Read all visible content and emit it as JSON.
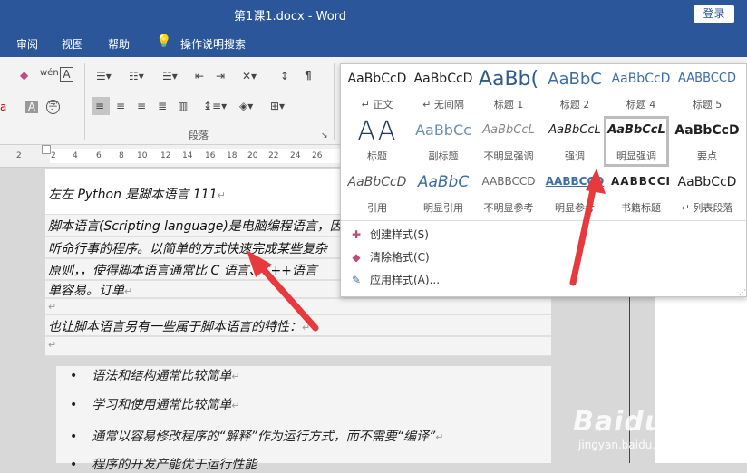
{
  "title_bar": {
    "title": "第1课1.docx  -  Word",
    "login_label": "登录"
  },
  "menu": {
    "tab_review": "审阅",
    "tab_view": "视图",
    "tab_help": "帮助",
    "search_label": "操作说明搜索"
  },
  "ribbon": {
    "group_label": "段落",
    "icons": [
      "eraser-icon",
      "phonetic-guide-icon",
      "char-border-icon",
      "bullets-icon",
      "numbering-icon",
      "multilevel-list-icon",
      "decrease-indent-icon",
      "increase-indent-icon",
      "char-scale-icon",
      "sort-icon",
      "show-marks-icon",
      "align-left-icon",
      "align-center-icon",
      "align-right-icon",
      "justify-icon",
      "distributed-icon",
      "line-spacing-icon",
      "shading-icon",
      "borders-icon"
    ]
  },
  "ruler": {
    "ticks": [
      "2",
      "2",
      "4",
      "6",
      "8",
      "10",
      "12",
      "14",
      "16",
      "18",
      "20",
      "22",
      "24",
      "26"
    ]
  },
  "document": {
    "line1": "左左 Python 是脚本语言 111",
    "para_line1": "脚本语言(Scripting language)是电脑编程语言，因",
    "para_line2": "听命行事的程序。以简单的方式快速完成某些复杂",
    "para_line3": "原则，，使得脚本语言通常比 C 语言、C++语言",
    "para_line4": "单容易。订单",
    "line_features": "也让脚本语言另有一些属于脚本语言的特性：",
    "bullets": [
      "语法和结构通常比较简单",
      "学习和使用通常比较简单",
      "通常以容易修改程序的“解释”作为运行方式，而不需要“编译”",
      "程序的开发产能优于运行性能"
    ],
    "para_mark": "↵",
    "empty_mark": "↵"
  },
  "styles_gallery": {
    "styles": [
      {
        "sample": "AaBbCcD",
        "name": "↵ 正文"
      },
      {
        "sample": "AaBbCcD",
        "name": "↵ 无间隔"
      },
      {
        "sample": "AaBb(",
        "name": "标题 1"
      },
      {
        "sample": "AaBbC",
        "name": "标题 2"
      },
      {
        "sample": "AaBbCcD",
        "name": "标题 4"
      },
      {
        "sample": "AABBCCD",
        "name": "标题 5"
      },
      {
        "sample": "AA",
        "name": "标题"
      },
      {
        "sample": "AaBbCc",
        "name": "副标题"
      },
      {
        "sample": "AaBbCcL",
        "name": "不明显强调"
      },
      {
        "sample": "AaBbCcL",
        "name": "强调"
      },
      {
        "sample": "AaBbCcL",
        "name": "明显强调"
      },
      {
        "sample": "AaBbCcD",
        "name": "要点"
      },
      {
        "sample": "AaBbCcD",
        "name": "引用"
      },
      {
        "sample": "AaBbC",
        "name": "明显引用"
      },
      {
        "sample": "AABBCCD",
        "name": "不明显参考"
      },
      {
        "sample": "AABBCCD",
        "name": "明显参考"
      },
      {
        "sample": "AABBCCI",
        "name": "书籍标题"
      },
      {
        "sample": "AaBbCcD",
        "name": "↵ 列表段落"
      }
    ],
    "actions": [
      "创建样式(S)",
      "清除格式(C)",
      "应用样式(A)..."
    ]
  },
  "watermark": {
    "brand": "Baidu经验",
    "url": "jingyan.baidu.com"
  },
  "colors": {
    "title_bar": "#2b579a",
    "annotation_arrow": "#e8393c",
    "selected_border": "#bdbdbd"
  }
}
